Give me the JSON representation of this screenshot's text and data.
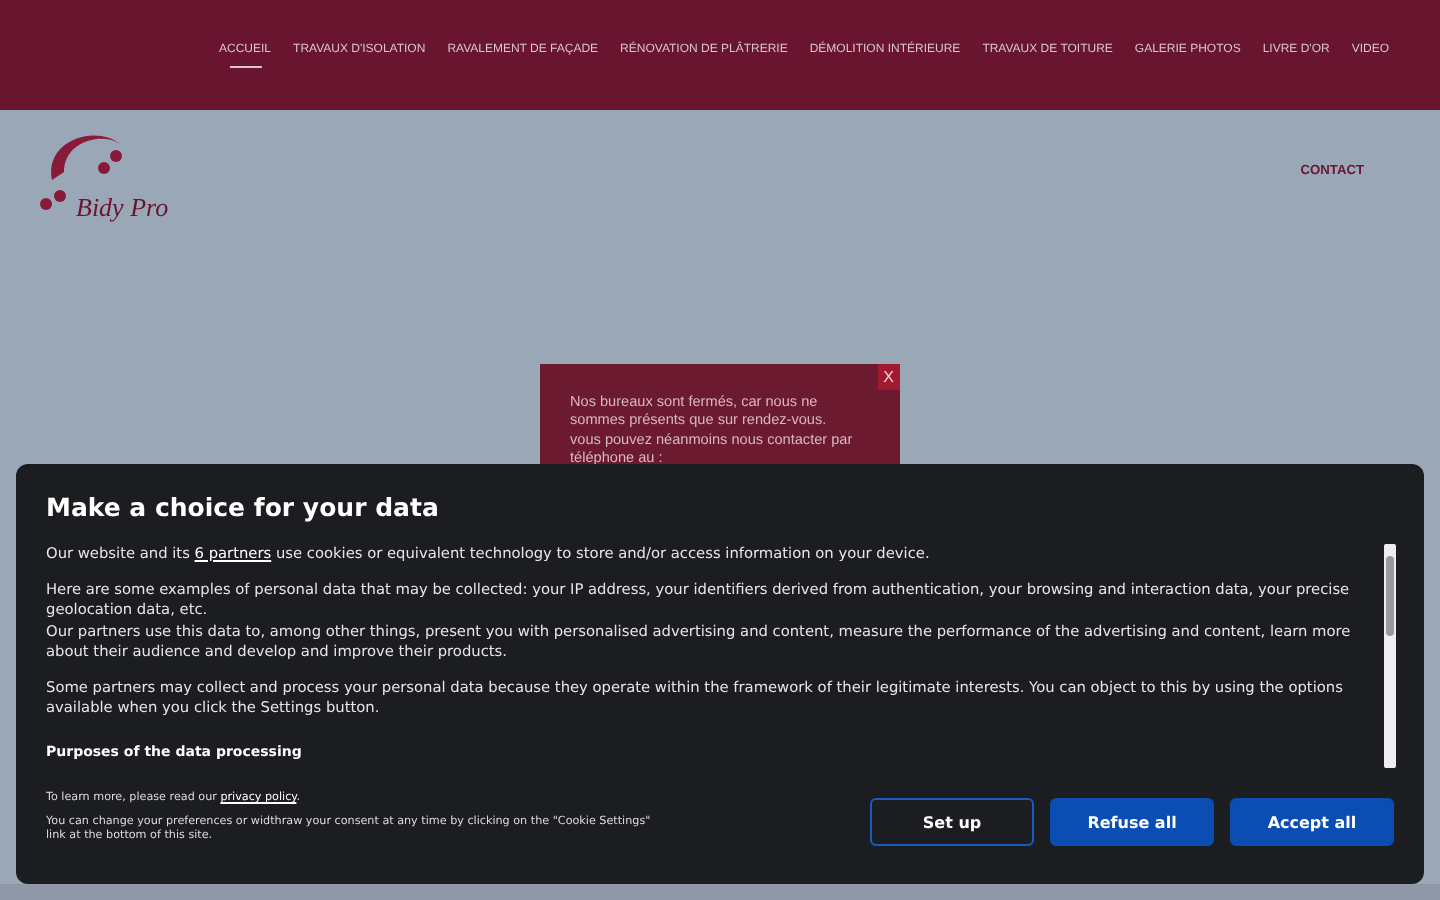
{
  "nav": {
    "items": [
      {
        "label": "ACCUEIL",
        "selected": true
      },
      {
        "label": "TRAVAUX D'ISOLATION",
        "selected": false
      },
      {
        "label": "RAVALEMENT DE FAÇADE",
        "selected": false
      },
      {
        "label": "RÉNOVATION DE PLÂTRERIE",
        "selected": false
      },
      {
        "label": "DÉMOLITION INTÉRIEURE",
        "selected": false
      },
      {
        "label": "TRAVAUX DE TOITURE",
        "selected": false
      },
      {
        "label": "GALERIE PHOTOS",
        "selected": false
      },
      {
        "label": "LIVRE D'OR",
        "selected": false
      },
      {
        "label": "VIDEO",
        "selected": false
      }
    ],
    "contact": "CONTACT"
  },
  "logo": {
    "text": "Bidy Pro"
  },
  "notice": {
    "close": "X",
    "lines": [
      "Nos bureaux sont fermés, car nous ne sommes présents que sur rendez-vous.",
      "vous pouvez néanmoins nous contacter par téléphone au :"
    ]
  },
  "consent": {
    "title": "Make a choice for your data",
    "intro": {
      "before": "Our website and its ",
      "link": "6 partners",
      "after": " use cookies or equivalent technology to store and/or access information on your device."
    },
    "paragraphs": [
      "Here are some examples of personal data that may be collected: your IP address, your identifiers derived from authentication, your browsing and interaction data, your precise geolocation data, etc.\nOur partners use this data to, among other things, present you with personalised advertising and content, measure the performance of the advertising and content, learn more about their audience and develop and improve their products.",
      "Some partners may collect and process your personal data because they operate within the framework of their legitimate interests. You can object to this by using the options available when you click the Settings button."
    ],
    "purposes_heading": "Purposes of the data processing",
    "learn_more": {
      "before": "To learn more, please read our ",
      "link": "privacy policy",
      "after": "."
    },
    "change_note": "You can change your preferences or widthraw your consent at any time by clicking on the \"Cookie Settings\" link at the bottom of this site.",
    "buttons": [
      {
        "label": "Set up",
        "kind": "outline"
      },
      {
        "label": "Refuse all",
        "kind": "solid"
      },
      {
        "label": "Accept all",
        "kind": "solid"
      }
    ]
  }
}
